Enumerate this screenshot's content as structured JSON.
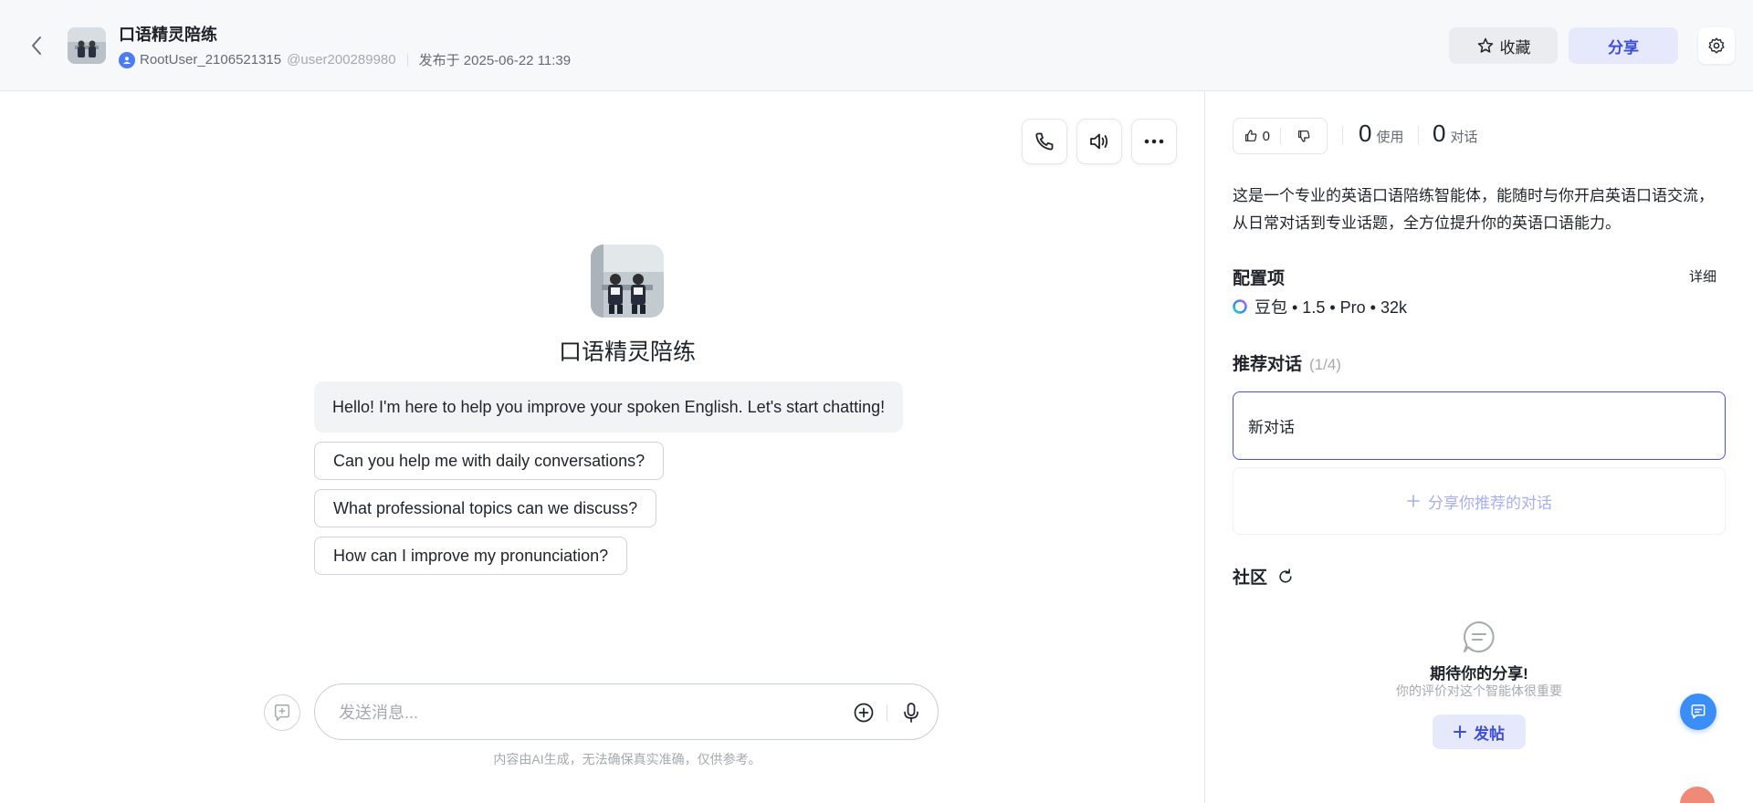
{
  "header": {
    "title": "口语精灵陪练",
    "username": "RootUser_2106521315",
    "handle": "@user200289980",
    "published": "发布于 2025-06-22 11:39",
    "favorite_label": "收藏",
    "share_label": "分享"
  },
  "chat": {
    "bot_name": "口语精灵陪练",
    "greeting": "Hello! I'm here to help you improve your spoken English. Let's start chatting!",
    "suggestions": [
      "Can you help me with daily conversations?",
      "What professional topics can we discuss?",
      "How can I improve my pronunciation?"
    ],
    "input_placeholder": "发送消息...",
    "disclaimer": "内容由AI生成，无法确保真实准确，仅供参考。"
  },
  "panel": {
    "like_count": "0",
    "usage_count": "0",
    "usage_label": "使用",
    "dialog_count": "0",
    "dialog_label": "对话",
    "description": "这是一个专业的英语口语陪练智能体，能随时与你开启英语口语交流，从日常对话到专业话题，全方位提升你的英语口语能力。",
    "config_title": "配置项",
    "detail_label": "详细",
    "model": "豆包 • 1.5 • Pro • 32k",
    "recommend_title": "推荐对话",
    "recommend_count": "(1/4)",
    "new_chat_label": "新对话",
    "share_recommend_label": "分享你推荐的对话",
    "community_title": "社区",
    "empty_title": "期待你的分享!",
    "empty_subtitle": "你的评价对这个智能体很重要",
    "post_label": "发帖"
  },
  "colors": {
    "accent": "#3d4fd6",
    "accent_bg": "#e6e9fb",
    "float_button": "#3b8df7"
  }
}
